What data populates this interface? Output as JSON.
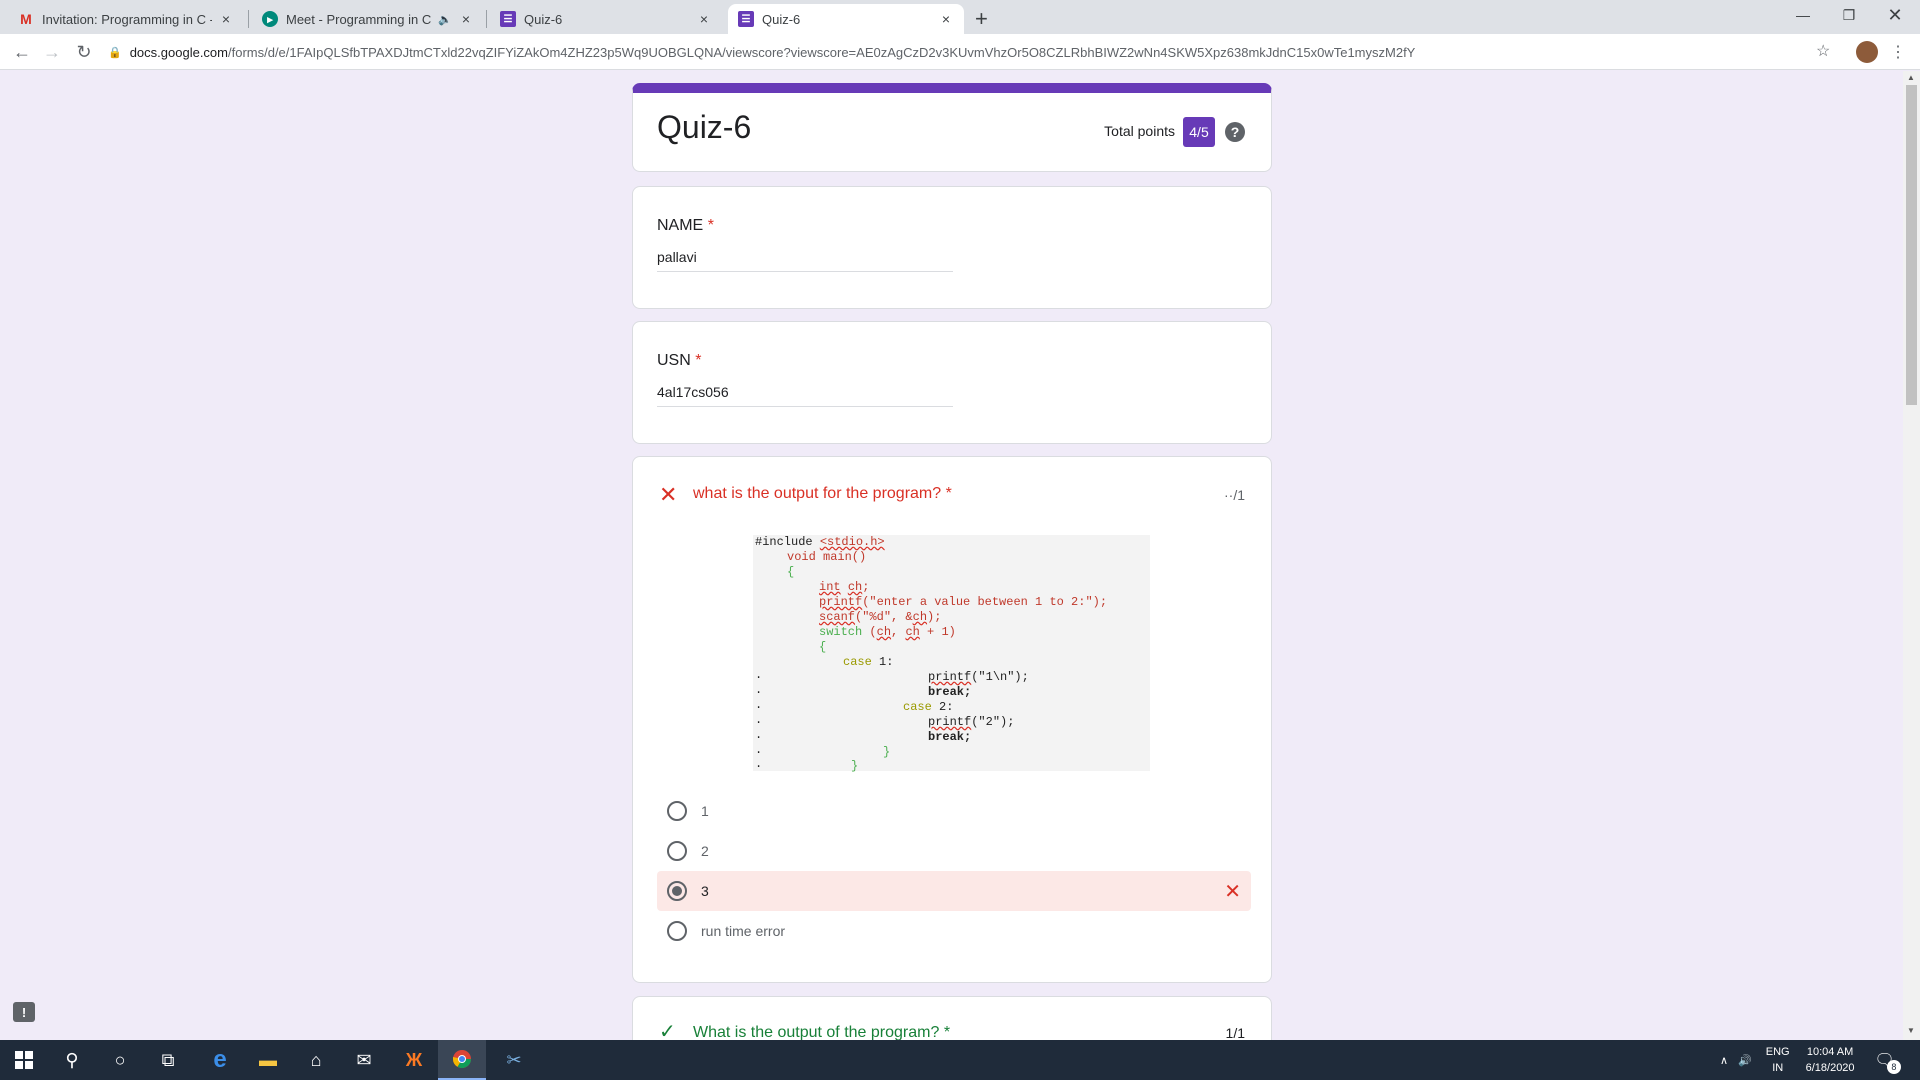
{
  "browser": {
    "tabs": [
      {
        "title": "Invitation: Programming in C - M",
        "icon": "gmail-icon",
        "close": "×"
      },
      {
        "title": "Meet - Programming in C - N",
        "icon": "meet-icon",
        "close": "×"
      },
      {
        "title": "Quiz-6",
        "icon": "forms-icon",
        "close": "×"
      },
      {
        "title": "Quiz-6",
        "icon": "forms-icon",
        "close": "×",
        "active": true
      }
    ],
    "new_tab": "+",
    "url_host": "docs.google.com",
    "url_path": "/forms/d/e/1FAIpQLSfbTPAXDJtmCTxld22vqZIFYiZAkOm4ZHZ23p5Wq9UOBGLQNA/viewscore?viewscore=AE0zAgCzD2v3KUvmVhzOr5O8CZLRbhBIWZ2wNn4SKW5Xpz638mkJdnC15x0wTe1myszM2fY"
  },
  "form": {
    "title": "Quiz-6",
    "total_points_label": "Total points",
    "total_points_value": "4/5",
    "help": "?",
    "required_mark": "*",
    "name_question": "NAME",
    "name_answer": "pallavi",
    "usn_question": "USN",
    "usn_answer": "4al17cs056",
    "quiz_question": "what is the output for the program?",
    "quiz_points": "··/1",
    "options": [
      "1",
      "2",
      "3",
      "run time error"
    ],
    "selected_option": "3",
    "next_question": "What is the output of the program?",
    "next_points": "1/1"
  },
  "code": {
    "include_kw": "#include",
    "include_hdr": "<stdio.h>",
    "l2": "void main()",
    "l3": "{",
    "l4_kw": "int",
    "l4_var": "ch",
    "l4_end": ";",
    "l5_fn": "printf",
    "l5_str": "(\"enter a value between 1 to 2:\");",
    "l6_fn": "scanf",
    "l6_str": "(\"%d\", &",
    "l6_var": "ch",
    "l6_end": ");",
    "l7_kw": "switch",
    "l7_a": " (",
    "l7_v1": "ch",
    "l7_b": ", ",
    "l7_v2": "ch",
    "l7_c": " + 1)",
    "l8": "{",
    "l9_kw": "case",
    "l9_v": " 1:",
    "l10_fn": "printf",
    "l10_str": "(\"1\\n\");",
    "l11": "break;",
    "l12_kw": "case",
    "l12_v": " 2:",
    "l13_fn": "printf",
    "l13_str": "(\"2\");",
    "l14": "break;",
    "l15": "}",
    "l16": "}",
    "dot": "."
  },
  "taskbar": {
    "lang_top": "ENG",
    "lang_bottom": "IN",
    "time": "10:04 AM",
    "date": "6/18/2020",
    "notif_count": "8"
  },
  "colors": {
    "accent": "#673ab7",
    "error": "#d93025",
    "success": "#188038",
    "page_bg": "#f0ebf8"
  }
}
